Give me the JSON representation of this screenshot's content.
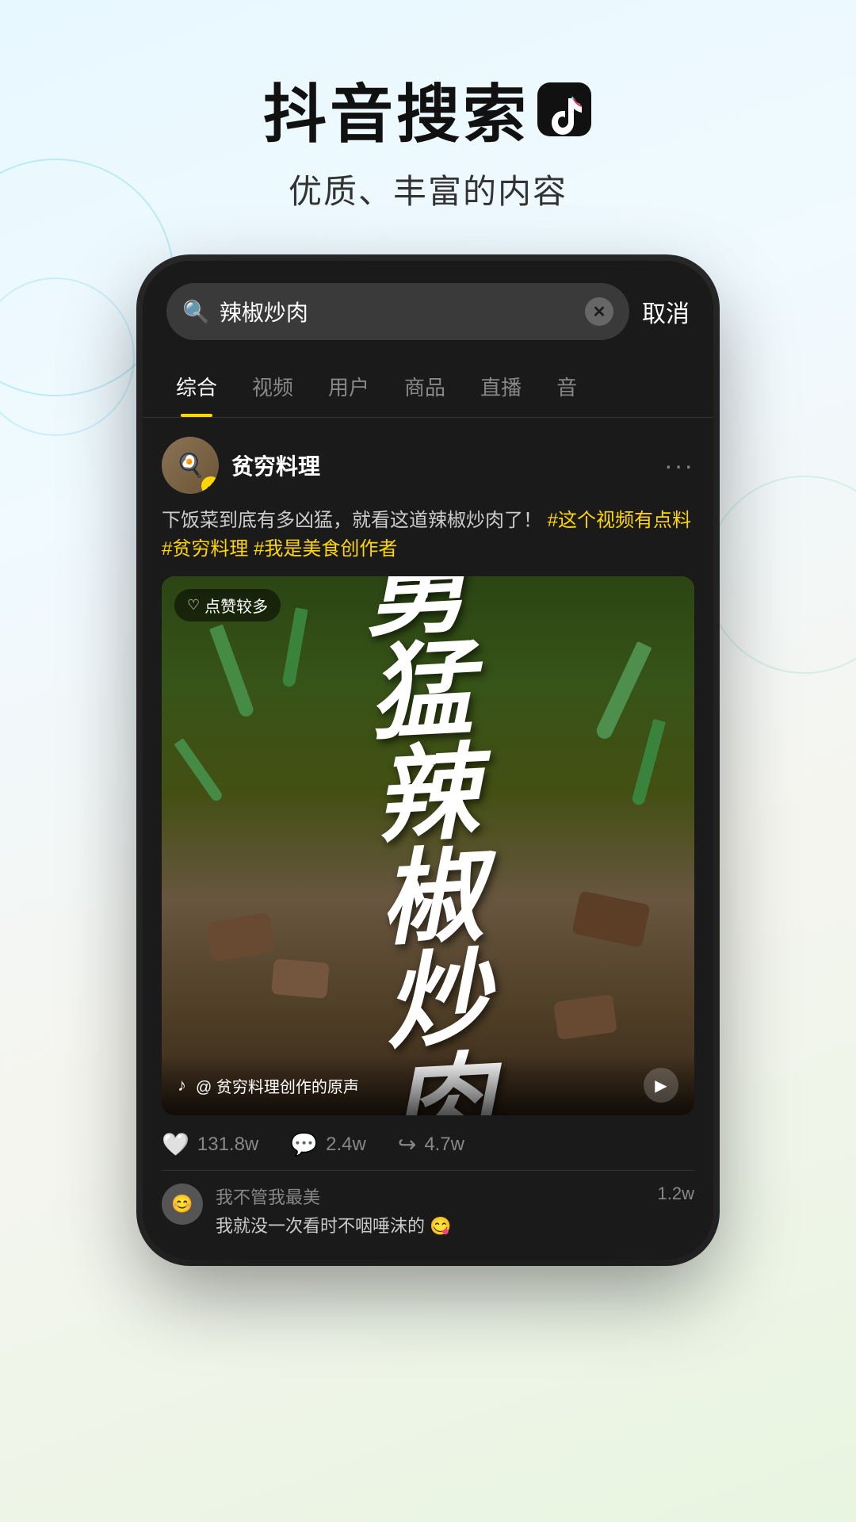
{
  "header": {
    "title": "抖音搜索",
    "logo_symbol": "♪",
    "subtitle": "优质、丰富的内容"
  },
  "phone": {
    "search": {
      "query": "辣椒炒肉",
      "cancel_label": "取消"
    },
    "tabs": [
      {
        "label": "综合",
        "active": true
      },
      {
        "label": "视频",
        "active": false
      },
      {
        "label": "用户",
        "active": false
      },
      {
        "label": "商品",
        "active": false
      },
      {
        "label": "直播",
        "active": false
      },
      {
        "label": "音",
        "active": false
      }
    ],
    "post": {
      "username": "贫穷料理",
      "verified": true,
      "text_before": "下饭菜到底有多凶猛，就看这道辣椒炒肉了！",
      "hashtags": "#这个视频有点料 #贫穷料理 #我是美食创作者",
      "video_tag": "点赞较多",
      "video_title_line1": "勇",
      "video_title_line2": "猛",
      "video_title_line3": "辣",
      "video_title_line4": "椒",
      "video_title_line5": "炒",
      "video_title_line6": "肉",
      "video_title_full": "勇猛辣椒炒肉",
      "audio_text": "@ 贫穷料理创作的原声",
      "stats": {
        "likes": "131.8w",
        "comments": "2.4w",
        "shares": "4.7w"
      }
    },
    "comments": [
      {
        "author": "我不管我最美",
        "text": "我就没一次看时不咽唾沫的 😋",
        "count": "1.2w"
      }
    ]
  }
}
